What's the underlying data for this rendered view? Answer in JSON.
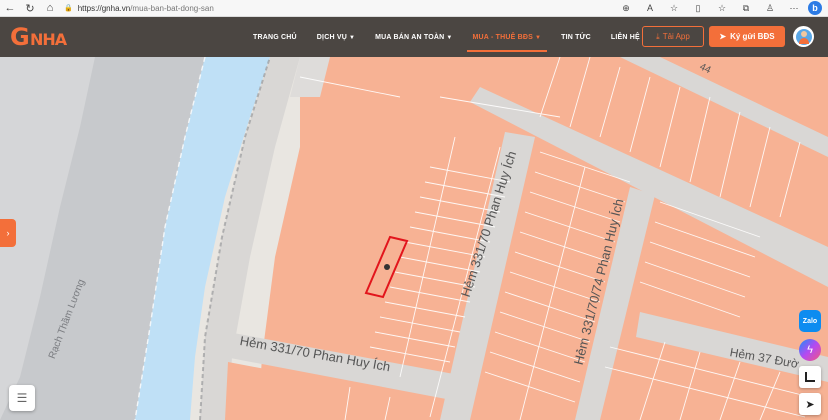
{
  "browser": {
    "back": "←",
    "reload": "↻",
    "home": "⌂",
    "lock": "🔒",
    "url_host": "https://gnha.vn",
    "url_path": "/mua-ban-bat-dong-san",
    "icons": [
      "zoom",
      "read-aloud",
      "favorite",
      "split-screen",
      "favorites",
      "collections",
      "extensions",
      "bing"
    ]
  },
  "header": {
    "logo_letter": "G",
    "logo_text": "NHA",
    "nav": [
      {
        "label": "TRANG CHỦ",
        "caret": ""
      },
      {
        "label": "DỊCH VỤ",
        "caret": "▼"
      },
      {
        "label": "MUA BÁN AN TOÀN",
        "caret": "▼"
      },
      {
        "label": "MUA - THUÊ BĐS",
        "caret": "▼",
        "active": true
      },
      {
        "label": "TIN TỨC",
        "caret": ""
      },
      {
        "label": "LIÊN HỆ",
        "caret": ""
      }
    ],
    "app_button": "Tải App",
    "post_button": "Ký gửi BĐS",
    "accent": "#f36f3a"
  },
  "map": {
    "labels": {
      "river": "Rạch Thầm Lương",
      "street_main": "Hẻm 331/70 Phan Huy Ích",
      "street_vertical_1": "Hẻm 331/70 Phan Huy Ích",
      "street_vertical_2": "Hẻm 331/70/74 Phan Huy Ích",
      "street_right": "Hẻm 37 Đườ",
      "street_top": "44"
    },
    "colors": {
      "parcel": "#f7b294",
      "road": "#d9d7d5",
      "water": "#bfe0f6",
      "land": "#e9e6e1",
      "river_bank": "#c7c9cc",
      "highlight": "#e2151c"
    }
  },
  "controls": {
    "side_tab": "›",
    "layers": "layers",
    "zalo": "Zalo",
    "messenger": "messenger",
    "measure": "measure",
    "locate": "➤"
  }
}
